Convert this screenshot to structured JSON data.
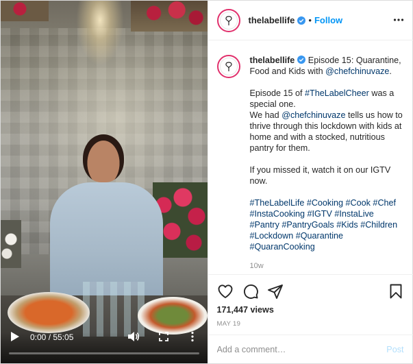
{
  "header": {
    "username": "thelabellife",
    "separator": "•",
    "follow_label": "Follow"
  },
  "caption": {
    "username": "thelabellife",
    "line1_text": "Episode 15: Quarantine, Food and Kids with ",
    "line1_mention": "@chefchinuvaze",
    "line1_end": ".",
    "p2_a": "Episode 15 of ",
    "p2_tag": "#TheLabelCheer",
    "p2_b": " was a special one.",
    "p3_a": "We had ",
    "p3_mention": "@chefchinuvaze",
    "p3_b": " tells us how to thrive through this lockdown with kids at home and with a stocked, nutritious pantry for them.",
    "p4": "If you missed it, watch it on our IGTV now.",
    "hashtags": "#TheLabelLife #Cooking #Cook #Chef #InstaCooking #IGTV #InstaLive #Pantry #PantryGoals #Kids #Children #Lockdown #Quarantine #QuaranCooking",
    "age": "10w"
  },
  "stats": {
    "views": "171,447 views",
    "date": "MAY 19"
  },
  "comment": {
    "placeholder": "Add a comment…",
    "post_label": "Post"
  },
  "video": {
    "time": "0:00 / 55:05",
    "progress": 0
  },
  "colors": {
    "link": "#00376b",
    "follow": "#0095f6",
    "post_disabled": "#b2dffc",
    "verified": "#3897f0"
  },
  "icons": [
    "verified-badge-icon",
    "more-options-icon",
    "heart-icon",
    "comment-bubble-icon",
    "share-paper-plane-icon",
    "bookmark-icon",
    "play-icon",
    "volume-icon",
    "fullscreen-icon",
    "video-more-icon",
    "brand-logo-icon"
  ]
}
